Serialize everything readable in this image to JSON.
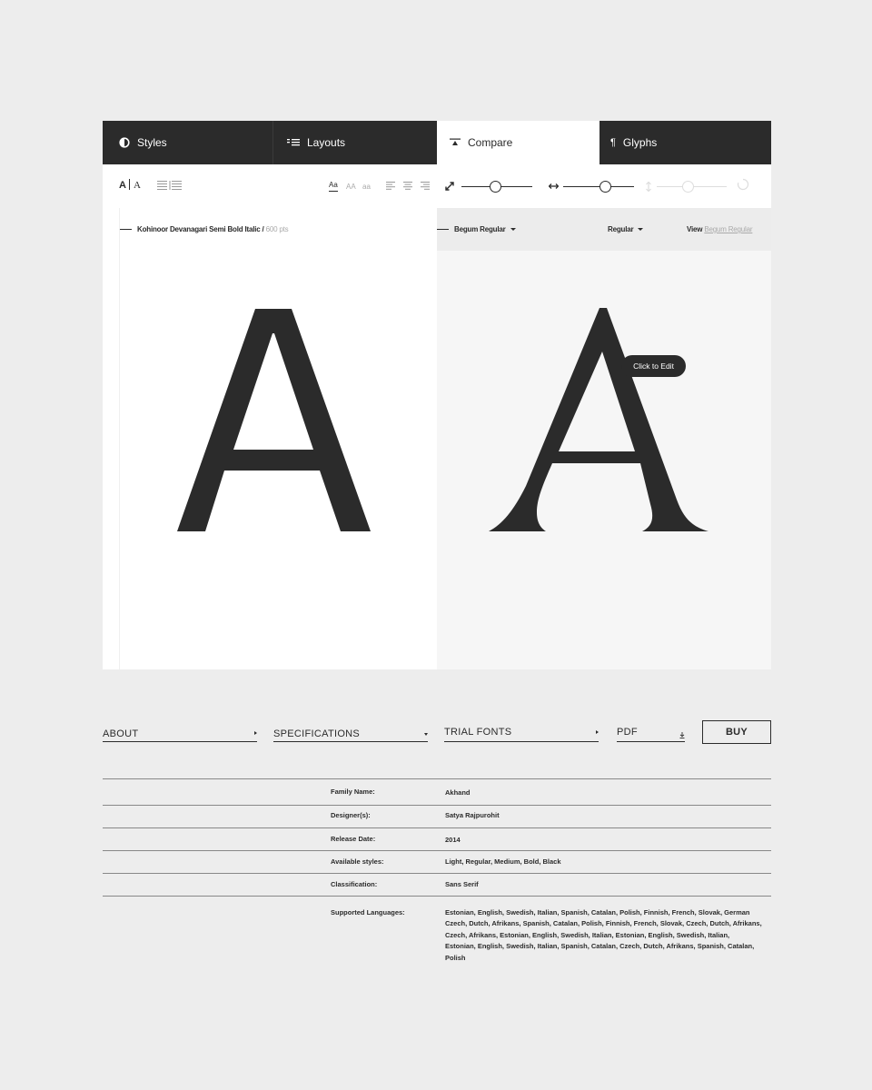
{
  "tabs": [
    {
      "label": "Styles",
      "icon": "styles-icon"
    },
    {
      "label": "Layouts",
      "icon": "layouts-icon"
    },
    {
      "label": "Compare",
      "icon": "compare-icon",
      "active": true
    },
    {
      "label": "Glyphs",
      "icon": "pilcrow-icon"
    }
  ],
  "toolbar": {
    "case_options": [
      "Aa",
      "AA",
      "aa"
    ],
    "selected_case": "Aa"
  },
  "left_panel": {
    "font_name": "Kohinoor Devanagari Semi Bold Italic /",
    "size": "600 pts",
    "glyph": "A"
  },
  "right_panel": {
    "font_select": "Begum Regular",
    "style_select": "Regular",
    "view_label": "View",
    "view_link": "Begum Regular",
    "glyph": "A",
    "tooltip": "Click to Edit"
  },
  "nav": {
    "about": "ABOUT",
    "specifications": "SPECIFICATIONS",
    "trial_fonts": "TRIAL FONTS",
    "pdf": "PDF",
    "buy": "BUY"
  },
  "specs": {
    "family_label": "Family Name:",
    "family_value": "Akhand",
    "designer_label": "Designer(s):",
    "designer_value": "Satya Rajpurohit",
    "release_label": "Release Date:",
    "release_value": "2014",
    "styles_label": "Available styles:",
    "styles_value": "Light, Regular, Medium, Bold, Black",
    "class_label": "Classification:",
    "class_value": "Sans Serif",
    "lang_label": "Supported Languages:",
    "lang_lines": [
      "Estonian, English, Swedish, Italian, Spanish, Catalan, Polish, Finnish, French, Slovak, German",
      "Czech, Dutch, Afrikans, Spanish, Catalan, Polish, Finnish, French, Slovak, Czech, Dutch, Afrikans,",
      "Czech, Afrikans, Estonian, English, Swedish, Italian, Estonian, English, Swedish, Italian,",
      "Estonian, English, Swedish, Italian, Spanish, Catalan, Czech, Dutch, Afrikans, Spanish, Catalan, Polish"
    ]
  }
}
